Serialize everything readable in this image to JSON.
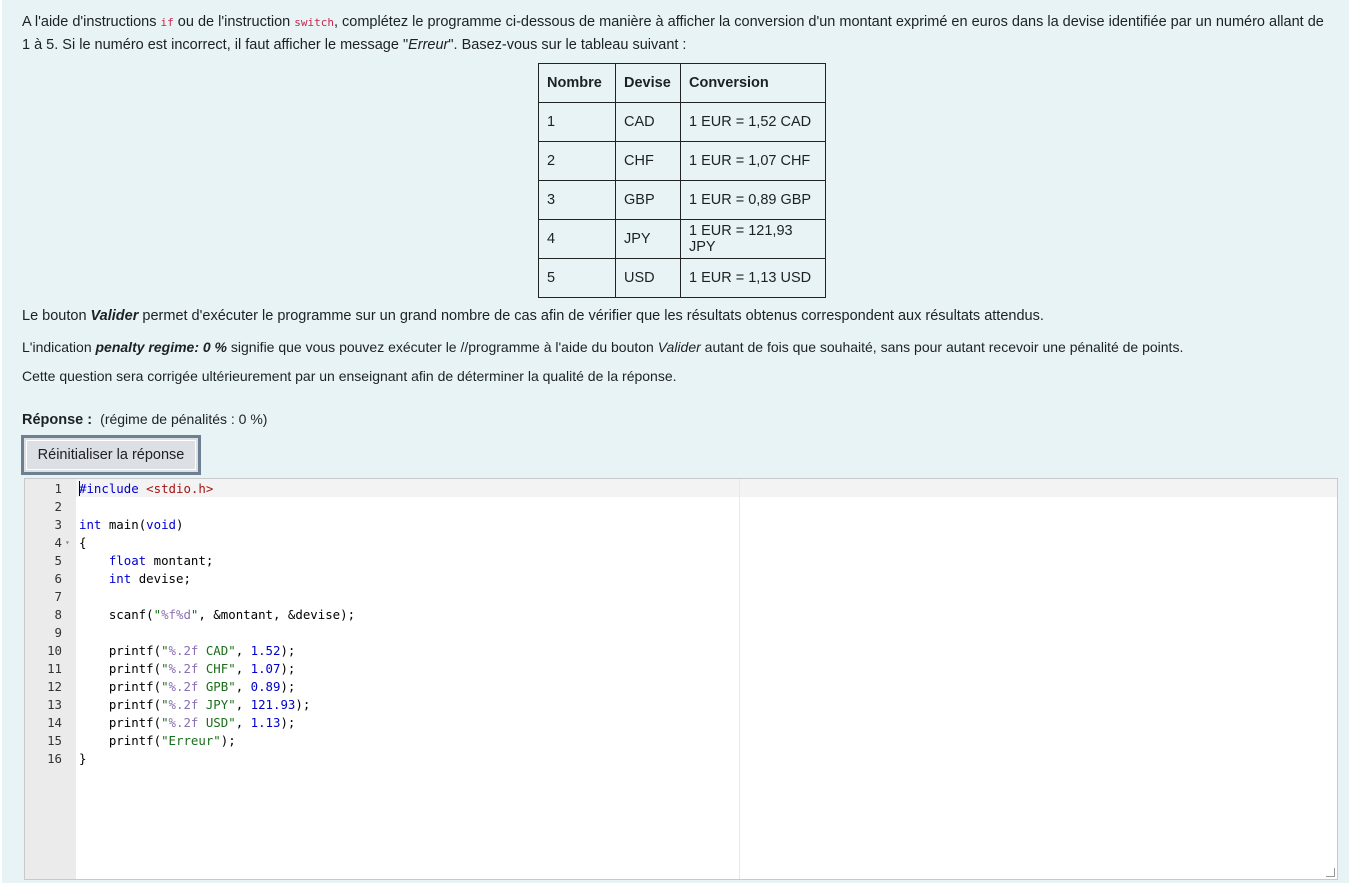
{
  "intro": {
    "t1": "A l'aide d'instructions ",
    "kw_if": "if",
    "t2": " ou de l'instruction ",
    "kw_switch": "switch",
    "t3": ", complétez le programme ci-dessous de manière à afficher la conversion d'un montant exprimé en euros dans la devise identifiée par un numéro allant de 1 à 5. Si le numéro est incorrect, il faut afficher le message \"",
    "erreur": "Erreur",
    "t4": "\". Basez-vous sur le tableau suivant :"
  },
  "table": {
    "headers": [
      "Nombre",
      "Devise",
      "Conversion"
    ],
    "rows": [
      [
        "1",
        "CAD",
        "1 EUR = 1,52 CAD"
      ],
      [
        "2",
        "CHF",
        "1 EUR = 1,07 CHF"
      ],
      [
        "3",
        "GBP",
        "1 EUR = 0,89 GBP"
      ],
      [
        "4",
        "JPY",
        "1 EUR = 121,93 JPY"
      ],
      [
        "5",
        "USD",
        "1 EUR = 1,13 USD"
      ]
    ]
  },
  "p1": {
    "a": "Le bouton ",
    "b": "Valider",
    "c": " permet d'exécuter le programme sur un grand nombre de cas afin de vérifier que les résultats obtenus correspondent aux résultats attendus."
  },
  "p2": {
    "a": "L'indication ",
    "b": "penalty regime: 0 %",
    "c": " signifie que vous pouvez exécuter le //programme à l'aide du bouton ",
    "d": "Valider",
    "e": " autant de fois que souhaité, sans pour autant recevoir une pénalité de points."
  },
  "p3": "Cette question sera corrigée ultérieurement par un enseignant afin de déterminer la qualité de la réponse.",
  "answer": {
    "label": "Réponse :",
    "penalty": "(régime de pénalités : 0 %)",
    "reset_button": "Réinitialiser la réponse"
  },
  "editor": {
    "line_numbers": [
      "1",
      "2",
      "3",
      "4",
      "5",
      "6",
      "7",
      "8",
      "9",
      "10",
      "11",
      "12",
      "13",
      "14",
      "15",
      "16"
    ],
    "line1_include": "#include",
    "line1_header": "<stdio.h>",
    "line3_kw1": "int",
    "line3_mid": " main(",
    "line3_kw2": "void",
    "line3_end": ")",
    "line4": "{",
    "line5_kw": "float",
    "line5_rest": " montant;",
    "line6_kw": "int",
    "line6_rest": " devise;",
    "line8_a": "scanf(",
    "line8_q1": "\"",
    "line8_fmt": "%f%d",
    "line8_q2": "\"",
    "line8_rest": ", &montant, &devise);",
    "printf_lines": [
      {
        "pre": "printf(",
        "q": "\"",
        "fmt": "%.2f",
        "txt": " CAD",
        "qe": "\"",
        "sep": ", ",
        "num": "1.52",
        "end": ");"
      },
      {
        "pre": "printf(",
        "q": "\"",
        "fmt": "%.2f",
        "txt": " CHF",
        "qe": "\"",
        "sep": ", ",
        "num": "1.07",
        "end": ");"
      },
      {
        "pre": "printf(",
        "q": "\"",
        "fmt": "%.2f",
        "txt": " GPB",
        "qe": "\"",
        "sep": ", ",
        "num": "0.89",
        "end": ");"
      },
      {
        "pre": "printf(",
        "q": "\"",
        "fmt": "%.2f",
        "txt": " JPY",
        "qe": "\"",
        "sep": ", ",
        "num": "121.93",
        "end": ");"
      },
      {
        "pre": "printf(",
        "q": "\"",
        "fmt": "%.2f",
        "txt": " USD",
        "qe": "\"",
        "sep": ", ",
        "num": "1.13",
        "end": ");"
      }
    ],
    "line15_a": "printf(",
    "line15_str": "\"Erreur\"",
    "line15_end": ");",
    "line16": "}",
    "fold_marker": "▾"
  }
}
